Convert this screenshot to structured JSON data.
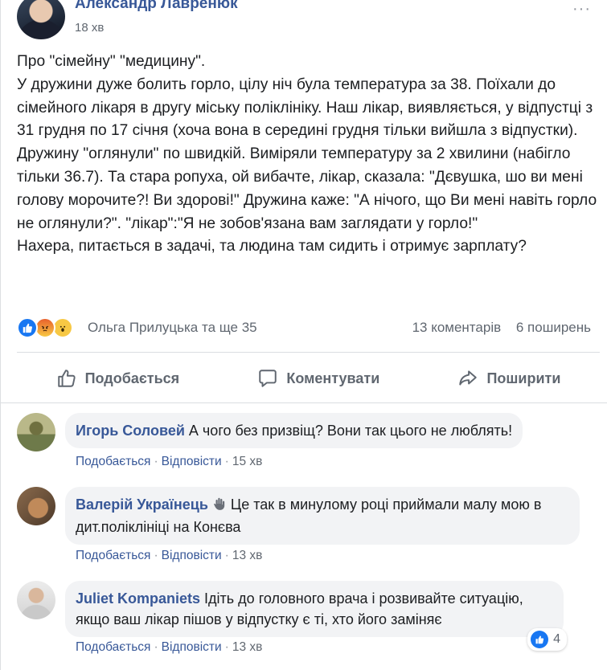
{
  "post": {
    "author": "Александр Лавренюк",
    "time": "18 хв",
    "more": "···",
    "text": "Про \"сімейну\" \"медицину\".\nУ дружини дуже болить горло, цілу ніч була температура за 38. Поїхали до сімейного лікаря в другу міську поліклініку. Наш лікар, виявляється, у відпустці з 31 грудня по 17 січня (хоча вона в середині грудня тільки вийшла з відпустки).\nДружину \"оглянули\" по швидкій. Виміряли температуру за 2 хвилини (набігло тільки 36.7). Та стара ропуха, ой вибачте, лікар, сказала: \"Дєвушка, шо ви мені голову морочите?! Ви здорові!\" Дружина каже: \"А нічого, що Ви мені навіть горло не оглянули?\". \"лікар\":\"Я не зобов'язана вам заглядати у горло!\"\nНахера, питається в задачі, та людина там сидить і отримує зарплату?",
    "reaction_names": "Ольга Прилуцька та ще 35",
    "comments_count": "13 коментарів",
    "shares_count": "6 поширень"
  },
  "actions": {
    "like": "Подобається",
    "comment": "Коментувати",
    "share": "Поширити"
  },
  "comments": [
    {
      "name": "Игорь Соловей",
      "text": "А чого без призвіщ? Вони так цього не люблять!",
      "like": "Подобається",
      "reply": "Відповісти",
      "time": "15 хв"
    },
    {
      "name": "Валерій Українець",
      "text": "Це так в минулому році приймали малу мою в дит.поліклініці на Конєва",
      "like": "Подобається",
      "reply": "Відповісти",
      "time": "13 хв"
    },
    {
      "name": "Juliet Kompaniets",
      "text": "Ідіть до головного врача і розвивайте ситуацію, якщо ваш лікар пішов у відпустку є ті, хто його заміняє",
      "like": "Подобається",
      "reply": "Відповісти",
      "time": "13 хв",
      "reaction_count": "4"
    }
  ],
  "colors": {
    "link": "#385898",
    "meta": "#606770",
    "bubble": "#f2f3f5",
    "like_blue": "#1877f2"
  }
}
